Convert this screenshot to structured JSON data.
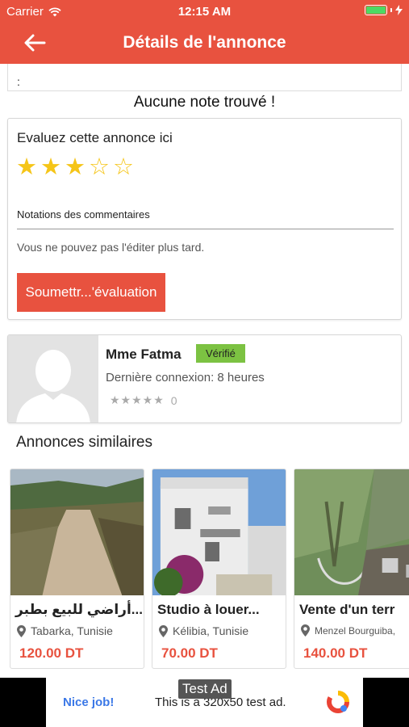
{
  "status_bar": {
    "carrier": "Carrier",
    "time": "12:15 AM"
  },
  "nav": {
    "title": "Détails de l'annonce"
  },
  "top_card": {
    "text": ":"
  },
  "rating_summary": {
    "empty_text": "Aucune note trouvé !"
  },
  "rate_form": {
    "title": "Evaluez cette annonce ici",
    "selected_stars": 3,
    "max_stars": 5,
    "comment_label": "Notations des commentaires",
    "warning": "Vous ne pouvez pas l'éditer plus tard.",
    "submit_label": "Soumettr...'évaluation"
  },
  "seller": {
    "name": "Mme Fatma",
    "badge": "Vérifié",
    "last_login": "Dernière connexion: 8 heures",
    "rating_stars": "★★★★★",
    "rating_count": "0"
  },
  "similar": {
    "title": "Annonces similaires",
    "items": [
      {
        "title": "أراضي للبيع بطبر...",
        "location": "Tabarka, Tunisie",
        "price": "120.00 DT"
      },
      {
        "title": "Studio à louer...",
        "location": "Kélibia, Tunisie",
        "price": "70.00 DT"
      },
      {
        "title": "Vente d'un terr",
        "location": "Menzel Bourguiba,",
        "price": "140.00 DT"
      }
    ]
  },
  "ad": {
    "badge": "Test Ad",
    "nice": "Nice job!",
    "text": "This is a 320x50 test ad."
  },
  "colors": {
    "brand": "#e8523f",
    "verified": "#7cc242",
    "star": "#f5c518"
  }
}
